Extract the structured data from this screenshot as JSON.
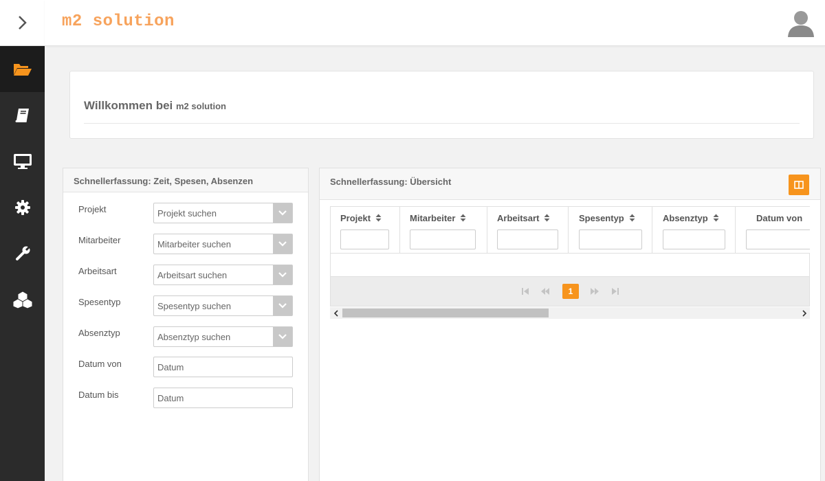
{
  "app": {
    "logo": "m2 solution"
  },
  "sidebar": {
    "items": [
      {
        "icon": "folder-open-icon",
        "active": true
      },
      {
        "icon": "book-icon"
      },
      {
        "icon": "monitor-icon"
      },
      {
        "icon": "gear-icon"
      },
      {
        "icon": "wrench-icon"
      },
      {
        "icon": "cubes-icon"
      }
    ]
  },
  "welcome": {
    "title": "Willkommen bei",
    "subtitle": "m2 solution"
  },
  "quick_entry": {
    "title": "Schnellerfassung: Zeit, Spesen, Absenzen",
    "fields": [
      {
        "label": "Projekt",
        "placeholder": "Projekt suchen"
      },
      {
        "label": "Mitarbeiter",
        "placeholder": "Mitarbeiter suchen"
      },
      {
        "label": "Arbeitsart",
        "placeholder": "Arbeitsart suchen"
      },
      {
        "label": "Spesentyp",
        "placeholder": "Spesentyp suchen"
      },
      {
        "label": "Absenztyp",
        "placeholder": "Absenztyp suchen"
      },
      {
        "label": "Datum von",
        "placeholder": "Datum"
      },
      {
        "label": "Datum bis",
        "placeholder": "Datum"
      }
    ]
  },
  "overview": {
    "title": "Schnellerfassung: Übersicht",
    "columns": [
      "Projekt",
      "Mitarbeiter",
      "Arbeitsart",
      "Spesentyp",
      "Absenztyp",
      "Datum von"
    ],
    "current_page": "1"
  },
  "colors": {
    "accent": "#f7941d",
    "sidebar": "#2b2b2b",
    "logo": "#f7a35c"
  }
}
